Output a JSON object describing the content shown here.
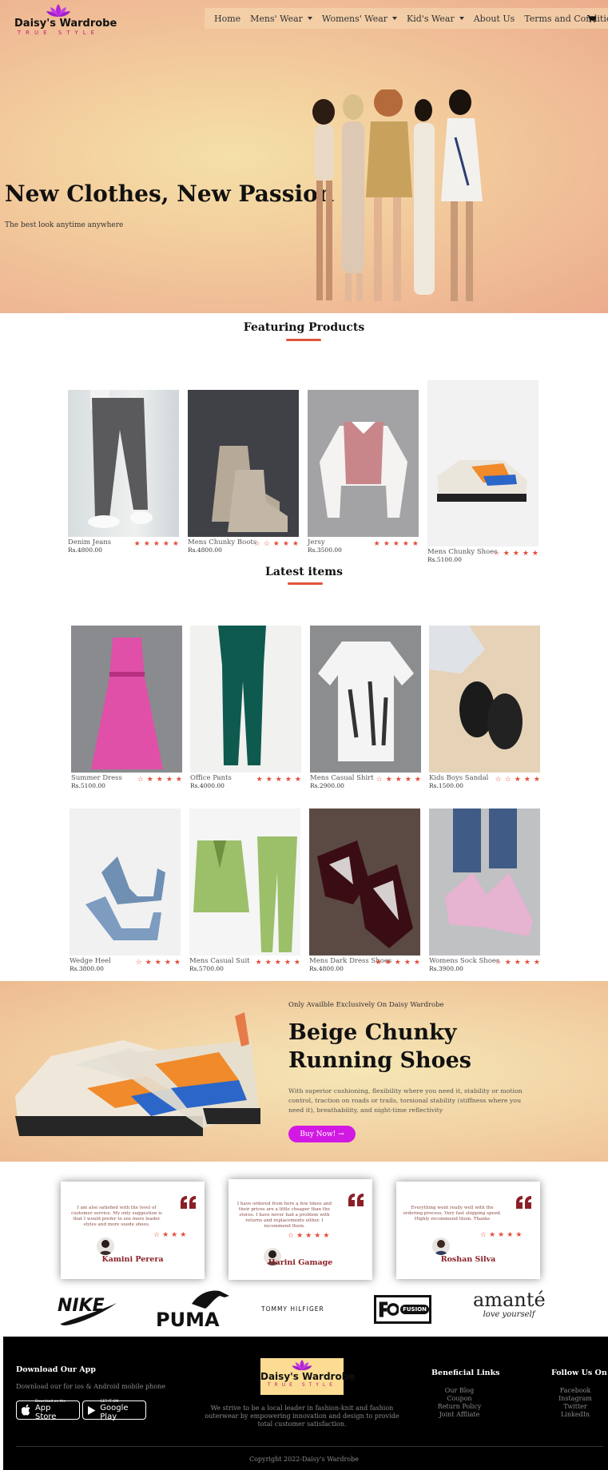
{
  "brand": {
    "name": "Daisy's Wardrobe",
    "tagline": "TRUE STYLE"
  },
  "nav": {
    "items": [
      {
        "label": "Home",
        "dropdown": false
      },
      {
        "label": "Mens' Wear",
        "dropdown": true
      },
      {
        "label": "Womens' Wear",
        "dropdown": true
      },
      {
        "label": "Kid's Wear",
        "dropdown": true
      },
      {
        "label": "About Us",
        "dropdown": false
      },
      {
        "label": "Terms and Conditions",
        "dropdown": false
      }
    ],
    "cart_icon": "cart-icon"
  },
  "hero": {
    "title": "New Clothes, New Passion",
    "subtitle": "The best look anytime anywhere"
  },
  "featuring": {
    "title": "Featuring Products",
    "products": [
      {
        "name": "Denim Jeans",
        "price": "Rs.4800.00",
        "rating": 5
      },
      {
        "name": "Mens Chunky Boots",
        "price": "Rs.4800.00",
        "rating": 3.5
      },
      {
        "name": "Jersy",
        "price": "Rs.3500.00",
        "rating": 5
      },
      {
        "name": "Mens Chunky Shoes",
        "price": "Rs.5100.00",
        "rating": 4
      }
    ]
  },
  "latest": {
    "title": "Latest items",
    "products": [
      {
        "name": "Summer Dress",
        "price": "Rs.5100.00",
        "rating": 4.5
      },
      {
        "name": "Office Pants",
        "price": "Rs.4000.00",
        "rating": 5
      },
      {
        "name": "Mens Casual Shirt",
        "price": "Rs.2900.00",
        "rating": 4
      },
      {
        "name": "Kids Boys Sandal",
        "price": "Rs.1500.00",
        "rating": 3.5
      },
      {
        "name": "Wedge Heel",
        "price": "Rs.3800.00",
        "rating": 4
      },
      {
        "name": "Mens Casual Suit",
        "price": "Rs.5700.00",
        "rating": 5
      },
      {
        "name": "Mens Dark Dress Shoes",
        "price": "Rs.4800.00",
        "rating": 5
      },
      {
        "name": "Womens Sock Shoes",
        "price": "Rs.3900.00",
        "rating": 4
      }
    ]
  },
  "promo": {
    "kicker": "Only Availble Exclusively On Daisy Wardrobe",
    "title": "Beige Chunky Running Shoes",
    "description": "With superior cushioning, flexibility where you need it, stability or motion control, traction on roads or trails, torsional stability (stiffness where you need it), breathability, and night-time reflectivity",
    "button": "Buy Now! →"
  },
  "testimonials": [
    {
      "quote": "I am also satisfied with the level of customer service. My only suggestion is that I would prefer to see more leader styles and more suede shoes.",
      "name": "Kamini Perera",
      "rating": 4
    },
    {
      "quote": "I have ordered from here a few times and their prices are a little cheaper than the stores. I have never had a problem with returns and replacements either. I recommend them.",
      "name": "Harini Gamage",
      "rating": 4
    },
    {
      "quote": "Everything went really well with the ordering process. Very fast shipping speed. Highly recommend them. Thanks",
      "name": "Roshan Silva",
      "rating": 4
    }
  ],
  "brands": [
    "NIKE",
    "PUMA",
    "TOMMY HILFIGER",
    "FUSION",
    "amanté",
    "love yourself"
  ],
  "footer": {
    "app_title": "Download Our App",
    "app_text": "Download our for ios & Android mobile phone",
    "appstore_small": "Download on the",
    "appstore_big": "App Store",
    "googleplay_small": "GET IT ON",
    "googleplay_big": "Google Play",
    "mission": "We strive to be a local leader in fashion-knit and fashion outerwear by empowering innovation and design to provide total customer satisfaction.",
    "links_title": "Beneficial Links",
    "links": [
      "Our Blog",
      "Coupon",
      "Return Policy",
      "Joint Affliate"
    ],
    "follow_title": "Follow Us On",
    "social": [
      "Facebook",
      "Instagram",
      "Twitter",
      "LinkedIn"
    ],
    "copyright": "Copyright 2022-Daisy's Wardrobe"
  },
  "colors": {
    "accent": "#e0553a",
    "button": "#d219e3",
    "brand_pink": "#c2187a",
    "name_red": "#8b1f26"
  }
}
